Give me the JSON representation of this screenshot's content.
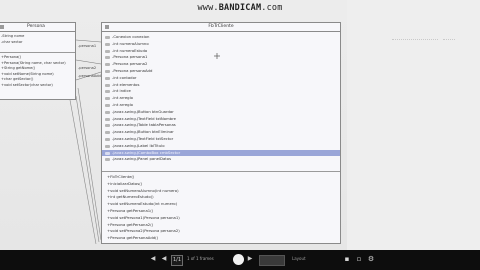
{
  "watermark": {
    "url": "www.",
    "brand": "BANDICAM",
    "tld": ".com"
  },
  "left_class": {
    "name": "Persona",
    "attributes": [
      "-String nome",
      "-char sector"
    ],
    "methods": [
      "+Persona()",
      "+Persona(String nome, char sector)",
      "+String getNome()",
      "+void setNome(String nome)",
      "+char getSector()",
      "+void setSector(char sector)"
    ]
  },
  "main_class": {
    "name": "FbTrCliente",
    "attributes": [
      "-Conexion conexion",
      "-int numeroAlumno",
      "-int numeroEstudo",
      "-Persona persona1",
      "-Persona persona2",
      "-Persona personaAdd",
      "-int contador",
      "-int elementos",
      "-int indice",
      "-int arreglo",
      "-int arreglo",
      "-javax.swing.JButton btnGuardar",
      "-javax.swing.JTextField txtNombre",
      "-javax.swing.JTable tablaPersonas",
      "-javax.swing.JButton btnEliminar",
      "-javax.swing.JTextField txtSector",
      "-javax.swing.JLabel lblTitulo",
      "-javax.swing.JComboBox cmbSector",
      "-javax.swing.JPanel panelDatos"
    ],
    "selected_index": 17,
    "methods": [
      "+FbTrCliente()",
      "+inicializarDatos()",
      "+void setNumeroAlumno(int numero)",
      "+int getNumeroEstudo()",
      "+void setNumeroEstudo(int numero)",
      "+Persona getPersona1()",
      "+void setPersona1(Persona persona1)",
      "+Persona getPersona2()",
      "+void setPersona2(Persona persona2)",
      "+Persona getPersonaAdd()"
    ]
  },
  "associations": [
    {
      "label": "-persona1"
    },
    {
      "label": "-persona2"
    },
    {
      "label": "-personaAdd"
    }
  ],
  "player": {
    "page_value": "1/1",
    "page_of": "1 of 1 frames",
    "selector": "Layout"
  }
}
